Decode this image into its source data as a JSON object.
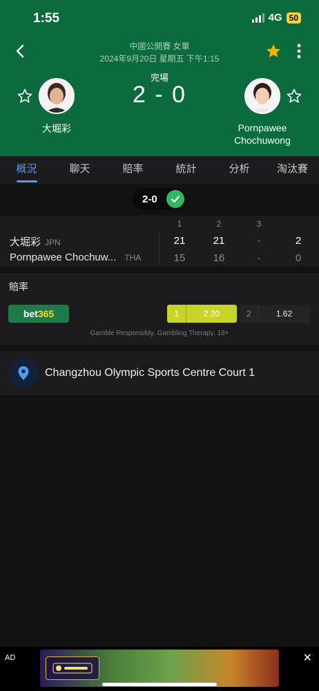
{
  "status_bar": {
    "time": "1:55",
    "network": "4G",
    "battery": "50"
  },
  "header": {
    "league": "中國公開賽 女單",
    "date": "2024年9月20日 星期五 下午1:15",
    "match_status": "完場",
    "score": "2 - 0",
    "player_left": {
      "name": "大堀彩"
    },
    "player_right": {
      "name_line1": "Pornpawee",
      "name_line2": "Chochuwong"
    },
    "favorite_color": "#f5b400"
  },
  "tabs": [
    "概況",
    "聊天",
    "賠率",
    "統計",
    "分析",
    "淘汰賽"
  ],
  "active_tab": "概況",
  "set_summary": "2-0",
  "score_table": {
    "set_headers": [
      "1",
      "2",
      "3"
    ],
    "rows": [
      {
        "name": "大堀彩",
        "country": "JPN",
        "sets": [
          "21",
          "21",
          "-"
        ],
        "total": "2"
      },
      {
        "name": "Pornpawee Chochuw...",
        "country": "THA",
        "sets": [
          "15",
          "16",
          "-"
        ],
        "total": "0"
      }
    ]
  },
  "odds": {
    "title": "賠率",
    "bookmaker_part1": "bet",
    "bookmaker_part2": "365",
    "option1": {
      "label": "1",
      "value": "2.20"
    },
    "option2": {
      "label": "2",
      "value": "1.62"
    },
    "disclaimer": "Gamble Responsibly. Gambling Therapy. 18+"
  },
  "venue": {
    "name": "Changzhou Olympic Sports Centre Court 1"
  },
  "ad": {
    "label": "AD",
    "close": "✕"
  }
}
